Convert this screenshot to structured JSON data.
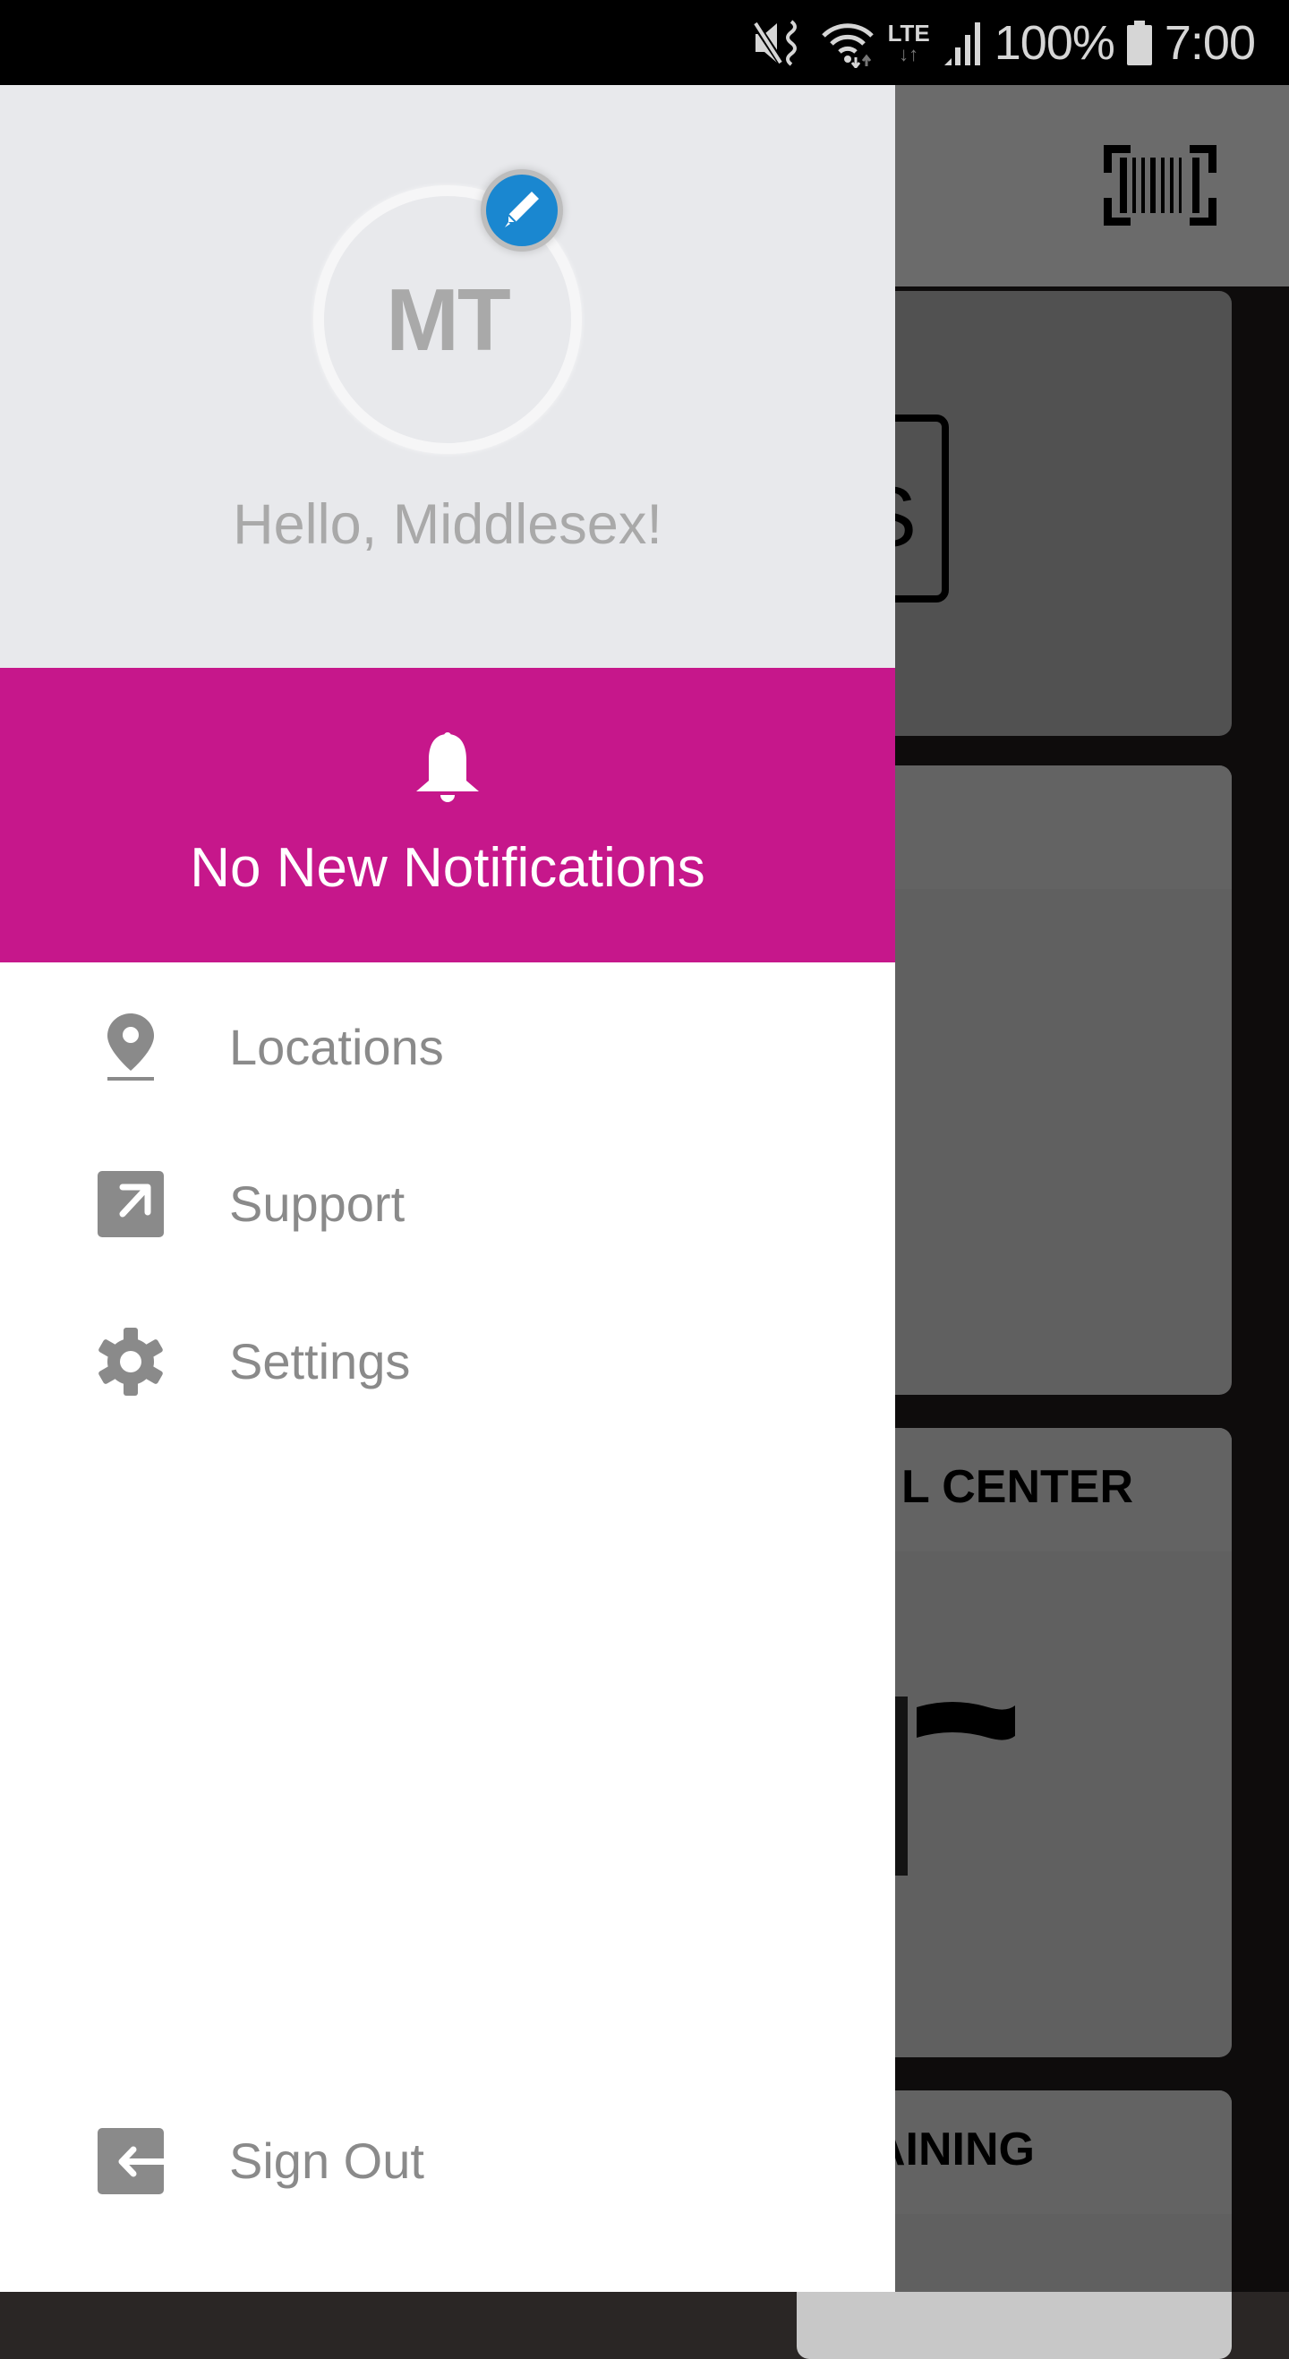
{
  "status_bar": {
    "icons": [
      "mute-vibrate-icon",
      "wifi-icon",
      "lte-icon",
      "signal-icon",
      "battery-icon"
    ],
    "network": "LTE",
    "battery": "100%",
    "time": "7:00"
  },
  "background_app": {
    "app_bar_icon": "barcode-scanner-icon",
    "cards": [
      {
        "title": "",
        "visible_text": "AS"
      },
      {
        "title": ""
      },
      {
        "title": "L CENTER",
        "icon": "flag-icon"
      },
      {
        "title": "RAINING"
      }
    ]
  },
  "drawer": {
    "profile": {
      "initials": "MT",
      "edit_icon": "pencil-icon",
      "greeting": "Hello, Middlesex!"
    },
    "notifications": {
      "icon": "bell-icon",
      "text": "No New Notifications"
    },
    "menu_items": [
      {
        "label": "Locations",
        "icon": "location-pin-icon"
      },
      {
        "label": "Support",
        "icon": "external-link-icon"
      },
      {
        "label": "Settings",
        "icon": "gear-icon"
      }
    ],
    "sign_out": {
      "label": "Sign Out",
      "icon": "sign-out-icon"
    }
  },
  "colors": {
    "accent": "#c6178b",
    "edit_badge": "#1a87d0",
    "header_bg": "#e8e9ec",
    "menu_text": "#8a8a8a",
    "greeting_text": "#a9a9a9"
  }
}
